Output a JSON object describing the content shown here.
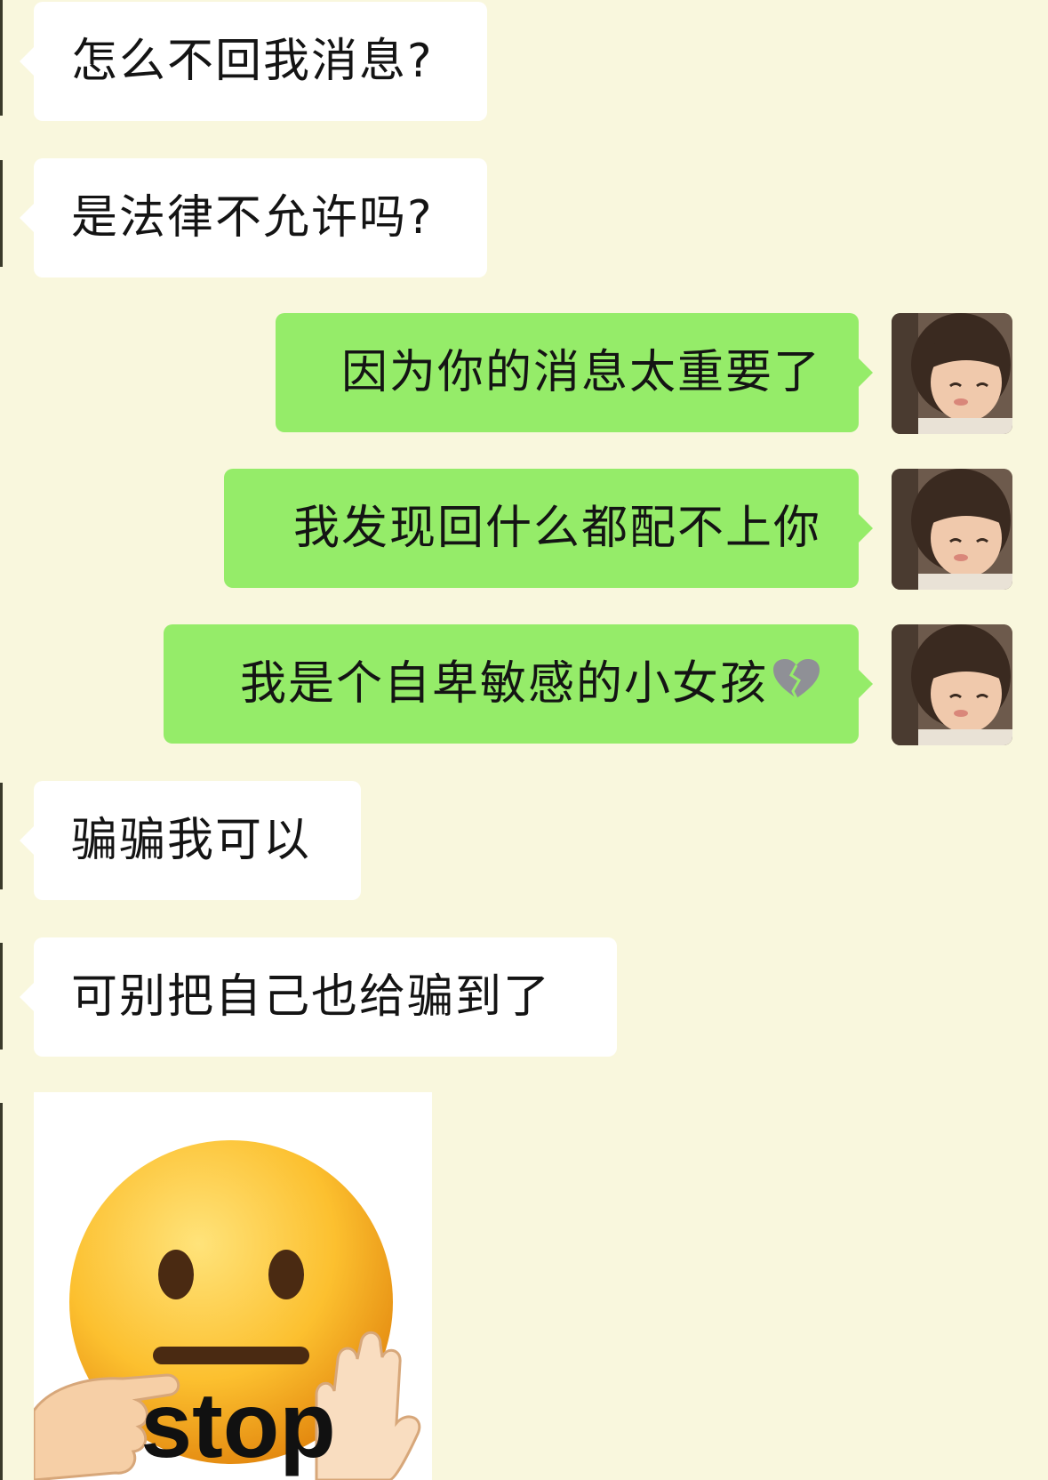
{
  "messages": [
    {
      "side": "in",
      "text": "怎么不回我消息?"
    },
    {
      "side": "in",
      "text": "是法律不允许吗?"
    },
    {
      "side": "out",
      "text": "因为你的消息太重要了"
    },
    {
      "side": "out",
      "text": "我发现回什么都配不上你"
    },
    {
      "side": "out",
      "text": "我是个自卑敏感的小女孩",
      "emoji": "broken-heart-icon"
    },
    {
      "side": "in",
      "text": "骗骗我可以"
    },
    {
      "side": "in",
      "text": "可别把自己也给骗到了"
    }
  ],
  "sticker": {
    "caption": "stop",
    "icon": "neutral-face-stop-sticker"
  },
  "colors": {
    "background": "#f9f7dd",
    "incoming_bubble": "#ffffff",
    "outgoing_bubble": "#95ec69"
  }
}
